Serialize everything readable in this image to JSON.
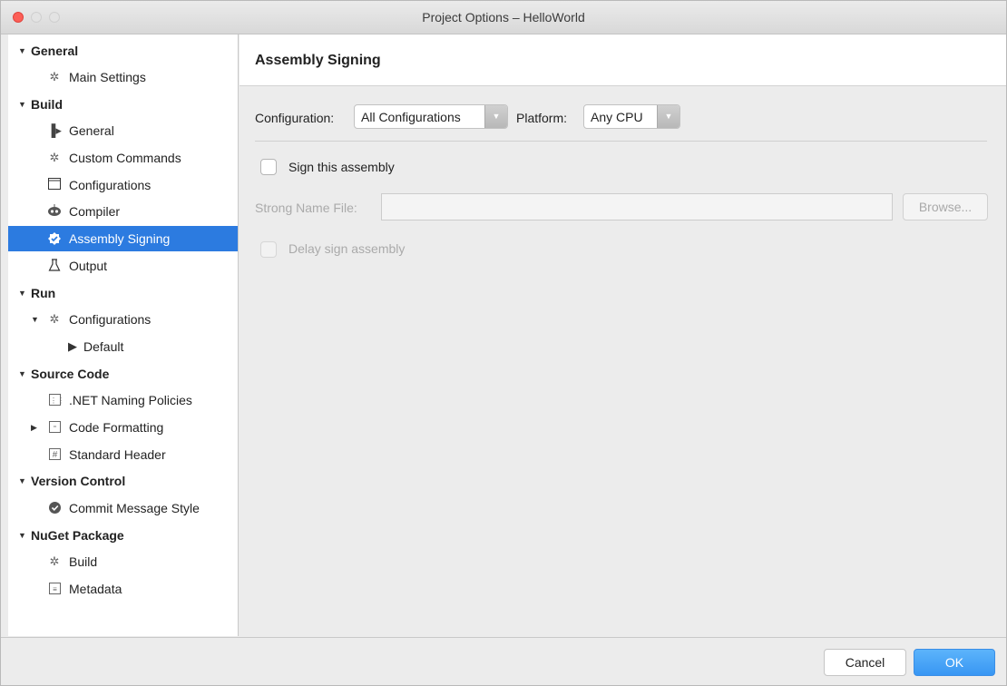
{
  "window": {
    "title": "Project Options – HelloWorld"
  },
  "sidebar": {
    "general": {
      "label": "General"
    },
    "main_settings": {
      "label": "Main Settings"
    },
    "build": {
      "label": "Build"
    },
    "build_general": {
      "label": "General"
    },
    "custom_commands": {
      "label": "Custom Commands"
    },
    "configurations": {
      "label": "Configurations"
    },
    "compiler": {
      "label": "Compiler"
    },
    "assembly_signing": {
      "label": "Assembly Signing"
    },
    "output": {
      "label": "Output"
    },
    "run": {
      "label": "Run"
    },
    "run_configurations": {
      "label": "Configurations"
    },
    "default": {
      "label": "Default"
    },
    "source_code": {
      "label": "Source Code"
    },
    "naming_policies": {
      "label": ".NET Naming Policies"
    },
    "code_formatting": {
      "label": "Code Formatting"
    },
    "standard_header": {
      "label": "Standard Header"
    },
    "version_control": {
      "label": "Version Control"
    },
    "commit_message_style": {
      "label": "Commit Message Style"
    },
    "nuget_package": {
      "label": "NuGet Package"
    },
    "nuget_build": {
      "label": "Build"
    },
    "metadata": {
      "label": "Metadata"
    },
    "selected": "Assembly Signing"
  },
  "main": {
    "title": "Assembly Signing",
    "configuration_label": "Configuration:",
    "configuration_value": "All Configurations",
    "platform_label": "Platform:",
    "platform_value": "Any CPU",
    "sign_label": "Sign this assembly",
    "sign_checked": false,
    "strong_name_label": "Strong Name File:",
    "strong_name_value": "",
    "browse_label": "Browse...",
    "delay_sign_label": "Delay sign assembly",
    "delay_sign_checked": false
  },
  "footer": {
    "cancel_label": "Cancel",
    "ok_label": "OK"
  },
  "colors": {
    "selection": "#2c7be0",
    "ok_button": "#3896f3",
    "close_button": "#fc5f57"
  },
  "icons": {
    "main_settings": "gear-icon",
    "build_general": "play-bar-icon",
    "custom_commands": "gear-icon",
    "configurations": "window-icon",
    "compiler": "compiler-icon",
    "assembly_signing": "badge-check-icon",
    "output": "flask-icon",
    "run_configurations": "gear-icon",
    "default": "play-icon",
    "naming_policies": "naming-icon",
    "code_formatting": "formatting-icon",
    "standard_header": "hash-icon",
    "commit_message_style": "commit-check-icon",
    "nuget_build": "gear-icon",
    "metadata": "document-icon"
  }
}
